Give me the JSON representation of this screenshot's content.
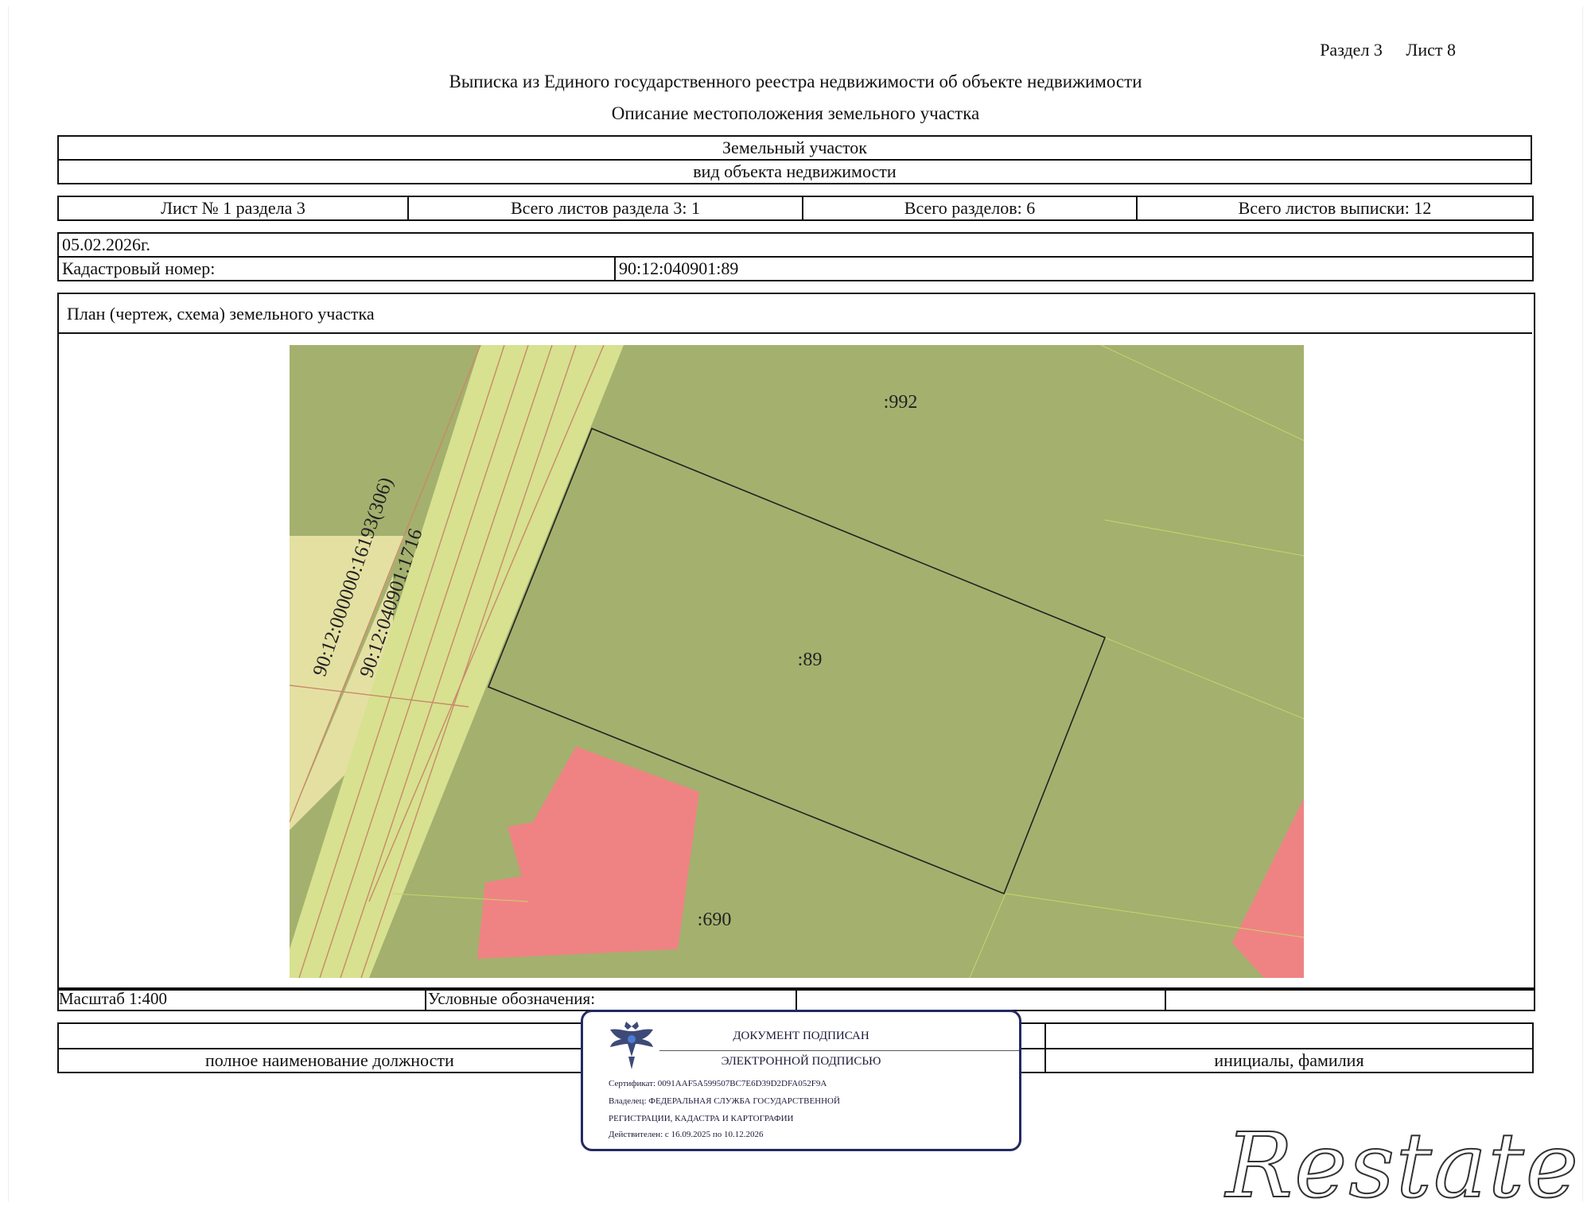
{
  "header": {
    "section": "Раздел 3",
    "sheet": "Лист 8",
    "title": "Выписка из Единого государственного реестра недвижимости об объекте недвижимости",
    "subtitle": "Описание местоположения земельного участка"
  },
  "object": {
    "type": "Земельный участок",
    "type_caption": "вид объекта недвижимости"
  },
  "sheets": {
    "sheet_no": "Лист № 1 раздела 3",
    "total_section_sheets": "Всего листов раздела 3: 1",
    "total_sections": "Всего разделов: 6",
    "total_extract_sheets": "Всего листов выписки: 12"
  },
  "record": {
    "date": "05.02.2026г.",
    "cadastral_label": "Кадастровый номер:",
    "cadastral_value": "90:12:040901:89"
  },
  "plan": {
    "title": "План (чертеж, схема) земельного участка",
    "labels": {
      "parcel_992": ":992",
      "parcel_89": ":89",
      "parcel_690": ":690",
      "road_label_1": "90:12:000000:16193(306)",
      "road_label_2": "90:12:040901:1716"
    },
    "colors": {
      "parcel": "#a4b06e",
      "road": "#d7e190",
      "yellow_area": "#e4e0a2",
      "building": "#ef8383",
      "boundary": "#222222",
      "road_lines": "#c9896a"
    }
  },
  "legend": {
    "scale": "Масштаб 1:400",
    "conventions": "Условные обозначения:"
  },
  "signature": {
    "position": "полное наименование должности",
    "name": "инициалы, фамилия"
  },
  "stamp": {
    "line1": "ДОКУМЕНТ ПОДПИСАН",
    "line2": "ЭЛЕКТРОННОЙ ПОДПИСЬЮ",
    "certificate": "Сертификат: 0091AAF5A599507BC7E6D39D2DFA052F9A",
    "owner1": "Владелец: ФЕДЕРАЛЬНАЯ СЛУЖБА ГОСУДАРСТВЕННОЙ",
    "owner2": "РЕГИСТРАЦИИ, КАДАСТРА И КАРТОГРАФИИ",
    "valid": "Действителен: с 16.09.2025 по 10.12.2026"
  },
  "watermark": "Restate"
}
